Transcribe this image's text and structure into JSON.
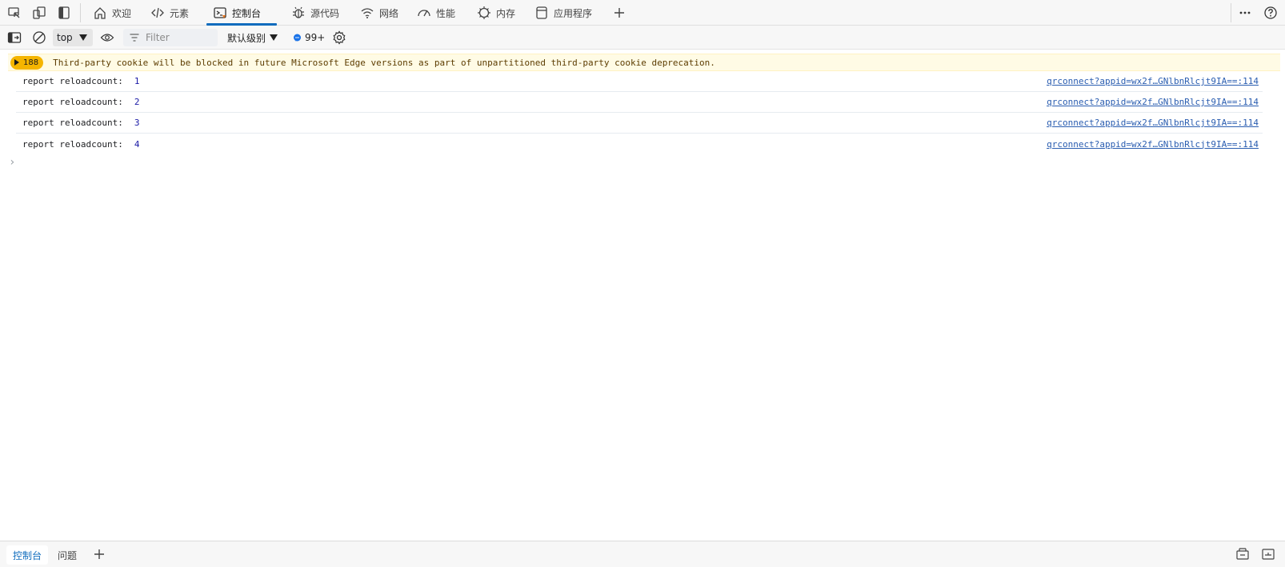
{
  "tabs": [
    {
      "label": "欢迎",
      "icon": "home-icon"
    },
    {
      "label": "元素",
      "icon": "code-icon"
    },
    {
      "label": "控制台",
      "icon": "console-icon",
      "active": true
    },
    {
      "label": "源代码",
      "icon": "bug-icon"
    },
    {
      "label": "网络",
      "icon": "wifi-icon"
    },
    {
      "label": "性能",
      "icon": "gauge-icon"
    },
    {
      "label": "内存",
      "icon": "chip-icon"
    },
    {
      "label": "应用程序",
      "icon": "app-icon"
    }
  ],
  "toolbar": {
    "context": "top",
    "filter_placeholder": "Filter",
    "level": "默认级别",
    "message_count": "99+"
  },
  "console": {
    "warning": {
      "count": "188",
      "text": "Third-party cookie will be blocked in future Microsoft Edge versions as part of unpartitioned third-party cookie deprecation."
    },
    "rows": [
      {
        "message": "report reloadcount:",
        "value": "1",
        "source": "qrconnect?appid=wx2f…GNlbnRlcjt9IA==:114"
      },
      {
        "message": "report reloadcount:",
        "value": "2",
        "source": "qrconnect?appid=wx2f…GNlbnRlcjt9IA==:114"
      },
      {
        "message": "report reloadcount:",
        "value": "3",
        "source": "qrconnect?appid=wx2f…GNlbnRlcjt9IA==:114"
      },
      {
        "message": "report reloadcount:",
        "value": "4",
        "source": "qrconnect?appid=wx2f…GNlbnRlcjt9IA==:114"
      }
    ],
    "prompt_glyph": "›"
  },
  "drawer": {
    "tabs": [
      {
        "label": "控制台",
        "active": true
      },
      {
        "label": "问题"
      }
    ]
  },
  "colors": {
    "accent": "#0f6cbd",
    "warning_badge": "#f5b500",
    "warning_bg": "#fffbe5",
    "link": "#2a5db0"
  }
}
